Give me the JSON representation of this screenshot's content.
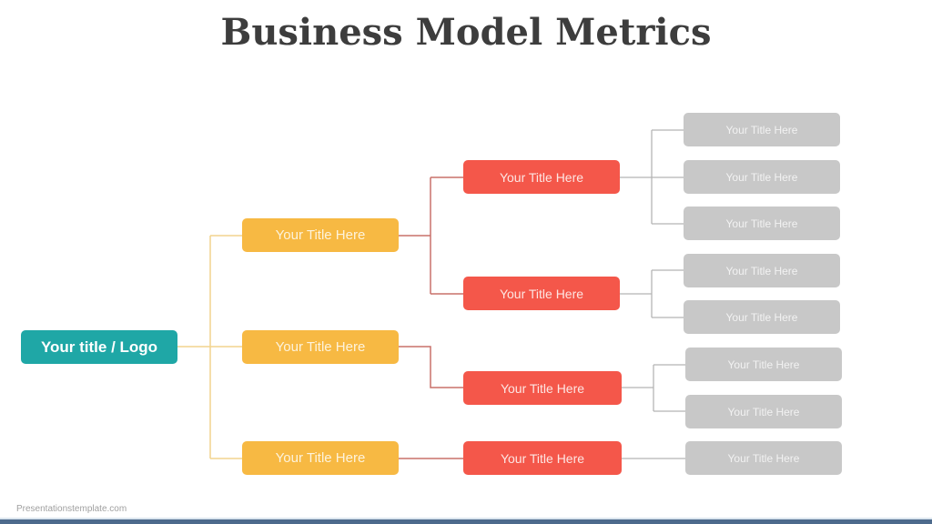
{
  "title": "Business Model Metrics",
  "colors": {
    "root": "#1fa7a6",
    "level1": "#f7b943",
    "level2": "#f4574a",
    "level3": "#c8c8c8",
    "connector_level1": "#f2d38e",
    "connector_level2": "#c9706a",
    "connector_level3": "#b5b5b5",
    "footer_bar": "#4d6a8c"
  },
  "root": {
    "label": "Your title / Logo"
  },
  "level1": [
    {
      "label": "Your Title Here"
    },
    {
      "label": "Your Title Here"
    },
    {
      "label": "Your Title Here"
    }
  ],
  "level2": [
    {
      "label": "Your Title Here",
      "parent": 0
    },
    {
      "label": "Your Title Here",
      "parent": 0
    },
    {
      "label": "Your Title Here",
      "parent": 1
    },
    {
      "label": "Your Title Here",
      "parent": 2
    }
  ],
  "level3": [
    {
      "label": "Your Title Here",
      "parent": 0
    },
    {
      "label": "Your Title Here",
      "parent": 0
    },
    {
      "label": "Your Title Here",
      "parent": 0
    },
    {
      "label": "Your Title Here",
      "parent": 1
    },
    {
      "label": "Your Title Here",
      "parent": 1
    },
    {
      "label": "Your Title Here",
      "parent": 2
    },
    {
      "label": "Your Title Here",
      "parent": 2
    },
    {
      "label": "Your Title Here",
      "parent": 3
    }
  ],
  "footer": {
    "credit": "Presentationstemplate.com"
  }
}
